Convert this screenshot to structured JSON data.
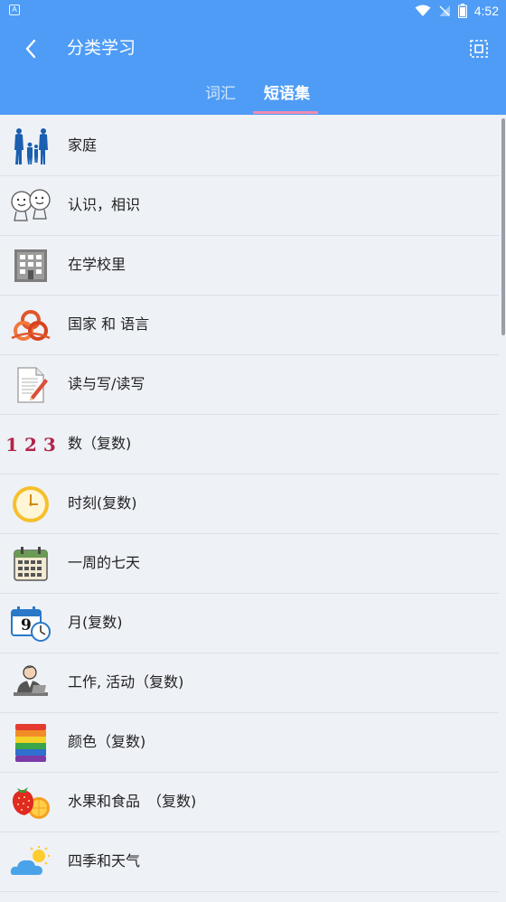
{
  "status_bar": {
    "notification_icon": "A",
    "time": "4:52"
  },
  "app_bar": {
    "title": "分类学习",
    "back_icon": "chevron-left-icon",
    "action_icon": "dashed-square-icon"
  },
  "tabs": [
    {
      "label": "词汇",
      "active": false
    },
    {
      "label": "短语集",
      "active": true
    }
  ],
  "categories": [
    {
      "label": "家庭",
      "icon": "family-icon"
    },
    {
      "label": "认识，相识",
      "icon": "faces-icon"
    },
    {
      "label": "在学校里",
      "icon": "school-building-icon"
    },
    {
      "label": "国家 和 语言",
      "icon": "flag-emblem-icon"
    },
    {
      "label": "读与写/读写",
      "icon": "document-pencil-icon"
    },
    {
      "label": "数（复数)",
      "icon": "numbers-icon",
      "icon_text": "1 2 3"
    },
    {
      "label": "时刻(复数)",
      "icon": "clock-icon"
    },
    {
      "label": "一周的七天",
      "icon": "calendar-icon"
    },
    {
      "label": "月(复数)",
      "icon": "calendar-clock-icon",
      "icon_text": "9"
    },
    {
      "label": "工作, 活动（复数)",
      "icon": "worker-icon"
    },
    {
      "label": "颜色（复数)",
      "icon": "color-stripes-icon"
    },
    {
      "label": "水果和食品　（复数)",
      "icon": "fruit-icon"
    },
    {
      "label": "四季和天气",
      "icon": "weather-icon"
    }
  ],
  "colors": {
    "app_bar": "#4e9cf5",
    "background": "#eef1f6",
    "tab_indicator": "#f28bb0",
    "numbers_red": "#b0234a"
  }
}
